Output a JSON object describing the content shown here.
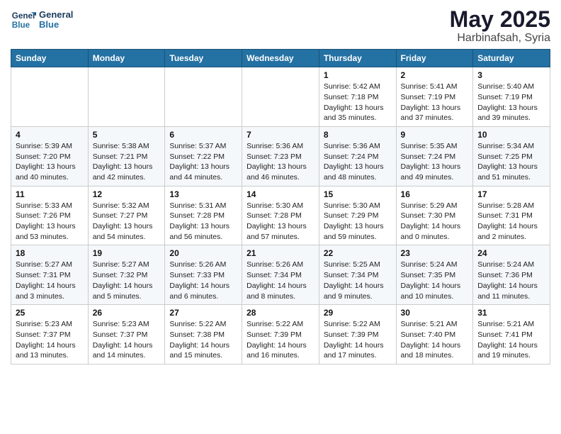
{
  "header": {
    "logo_line1": "General",
    "logo_line2": "Blue",
    "title": "May 2025",
    "subtitle": "Harbinafsah, Syria"
  },
  "columns": [
    "Sunday",
    "Monday",
    "Tuesday",
    "Wednesday",
    "Thursday",
    "Friday",
    "Saturday"
  ],
  "weeks": [
    [
      {
        "day": "",
        "info": ""
      },
      {
        "day": "",
        "info": ""
      },
      {
        "day": "",
        "info": ""
      },
      {
        "day": "",
        "info": ""
      },
      {
        "day": "1",
        "info": "Sunrise: 5:42 AM\nSunset: 7:18 PM\nDaylight: 13 hours\nand 35 minutes."
      },
      {
        "day": "2",
        "info": "Sunrise: 5:41 AM\nSunset: 7:19 PM\nDaylight: 13 hours\nand 37 minutes."
      },
      {
        "day": "3",
        "info": "Sunrise: 5:40 AM\nSunset: 7:19 PM\nDaylight: 13 hours\nand 39 minutes."
      }
    ],
    [
      {
        "day": "4",
        "info": "Sunrise: 5:39 AM\nSunset: 7:20 PM\nDaylight: 13 hours\nand 40 minutes."
      },
      {
        "day": "5",
        "info": "Sunrise: 5:38 AM\nSunset: 7:21 PM\nDaylight: 13 hours\nand 42 minutes."
      },
      {
        "day": "6",
        "info": "Sunrise: 5:37 AM\nSunset: 7:22 PM\nDaylight: 13 hours\nand 44 minutes."
      },
      {
        "day": "7",
        "info": "Sunrise: 5:36 AM\nSunset: 7:23 PM\nDaylight: 13 hours\nand 46 minutes."
      },
      {
        "day": "8",
        "info": "Sunrise: 5:36 AM\nSunset: 7:24 PM\nDaylight: 13 hours\nand 48 minutes."
      },
      {
        "day": "9",
        "info": "Sunrise: 5:35 AM\nSunset: 7:24 PM\nDaylight: 13 hours\nand 49 minutes."
      },
      {
        "day": "10",
        "info": "Sunrise: 5:34 AM\nSunset: 7:25 PM\nDaylight: 13 hours\nand 51 minutes."
      }
    ],
    [
      {
        "day": "11",
        "info": "Sunrise: 5:33 AM\nSunset: 7:26 PM\nDaylight: 13 hours\nand 53 minutes."
      },
      {
        "day": "12",
        "info": "Sunrise: 5:32 AM\nSunset: 7:27 PM\nDaylight: 13 hours\nand 54 minutes."
      },
      {
        "day": "13",
        "info": "Sunrise: 5:31 AM\nSunset: 7:28 PM\nDaylight: 13 hours\nand 56 minutes."
      },
      {
        "day": "14",
        "info": "Sunrise: 5:30 AM\nSunset: 7:28 PM\nDaylight: 13 hours\nand 57 minutes."
      },
      {
        "day": "15",
        "info": "Sunrise: 5:30 AM\nSunset: 7:29 PM\nDaylight: 13 hours\nand 59 minutes."
      },
      {
        "day": "16",
        "info": "Sunrise: 5:29 AM\nSunset: 7:30 PM\nDaylight: 14 hours\nand 0 minutes."
      },
      {
        "day": "17",
        "info": "Sunrise: 5:28 AM\nSunset: 7:31 PM\nDaylight: 14 hours\nand 2 minutes."
      }
    ],
    [
      {
        "day": "18",
        "info": "Sunrise: 5:27 AM\nSunset: 7:31 PM\nDaylight: 14 hours\nand 3 minutes."
      },
      {
        "day": "19",
        "info": "Sunrise: 5:27 AM\nSunset: 7:32 PM\nDaylight: 14 hours\nand 5 minutes."
      },
      {
        "day": "20",
        "info": "Sunrise: 5:26 AM\nSunset: 7:33 PM\nDaylight: 14 hours\nand 6 minutes."
      },
      {
        "day": "21",
        "info": "Sunrise: 5:26 AM\nSunset: 7:34 PM\nDaylight: 14 hours\nand 8 minutes."
      },
      {
        "day": "22",
        "info": "Sunrise: 5:25 AM\nSunset: 7:34 PM\nDaylight: 14 hours\nand 9 minutes."
      },
      {
        "day": "23",
        "info": "Sunrise: 5:24 AM\nSunset: 7:35 PM\nDaylight: 14 hours\nand 10 minutes."
      },
      {
        "day": "24",
        "info": "Sunrise: 5:24 AM\nSunset: 7:36 PM\nDaylight: 14 hours\nand 11 minutes."
      }
    ],
    [
      {
        "day": "25",
        "info": "Sunrise: 5:23 AM\nSunset: 7:37 PM\nDaylight: 14 hours\nand 13 minutes."
      },
      {
        "day": "26",
        "info": "Sunrise: 5:23 AM\nSunset: 7:37 PM\nDaylight: 14 hours\nand 14 minutes."
      },
      {
        "day": "27",
        "info": "Sunrise: 5:22 AM\nSunset: 7:38 PM\nDaylight: 14 hours\nand 15 minutes."
      },
      {
        "day": "28",
        "info": "Sunrise: 5:22 AM\nSunset: 7:39 PM\nDaylight: 14 hours\nand 16 minutes."
      },
      {
        "day": "29",
        "info": "Sunrise: 5:22 AM\nSunset: 7:39 PM\nDaylight: 14 hours\nand 17 minutes."
      },
      {
        "day": "30",
        "info": "Sunrise: 5:21 AM\nSunset: 7:40 PM\nDaylight: 14 hours\nand 18 minutes."
      },
      {
        "day": "31",
        "info": "Sunrise: 5:21 AM\nSunset: 7:41 PM\nDaylight: 14 hours\nand 19 minutes."
      }
    ]
  ]
}
